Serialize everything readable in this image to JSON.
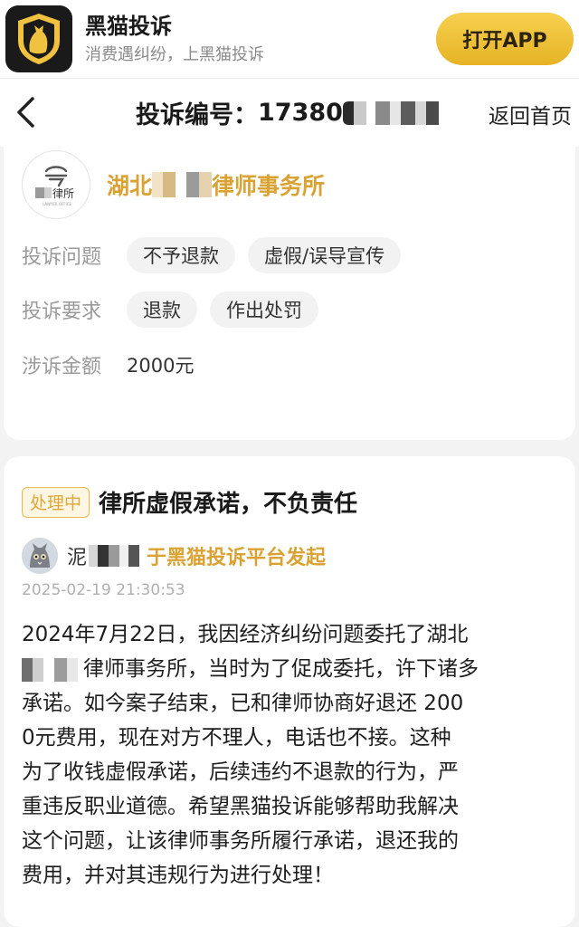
{
  "app_banner": {
    "name": "黑猫投诉",
    "slogan": "消费遇纠纷，上黑猫投诉",
    "open_button": "打开APP",
    "logo_icon": "black-cat-shield-icon"
  },
  "nav": {
    "back_icon": "chevron-left-icon",
    "title_prefix": "投诉编号：",
    "title_number_visible": "17380",
    "home_link": "返回首页"
  },
  "company": {
    "logo_text": "律所",
    "name_prefix": "湖北",
    "name_suffix": "律师事务所",
    "issues_label": "投诉问题",
    "issues": [
      "不予退款",
      "虚假/误导宣传"
    ],
    "requests_label": "投诉要求",
    "requests": [
      "退款",
      "作出处罚"
    ],
    "amount_label": "涉诉金额",
    "amount": "2000元"
  },
  "complaint": {
    "status": "处理中",
    "title": "律所虚假承诺，不负责任",
    "user_name_visible": "泥",
    "platform_text": "于黑猫投诉平台发起",
    "timestamp": "2025-02-19 21:30:53",
    "body_lines": [
      "2024年7月22日，我因经济纠纷问题委托了湖北",
      "律师事务所，当时为了促成委托，许下诸多",
      "承诺。如今案子结束，已和律师协商好退还 200",
      "0元费用，现在对方不理人，电话也不接。这种",
      "为了收钱虚假承诺，后续违约不退款的行为，严",
      "重违反职业道德。希望黑猫投诉能够帮助我解决",
      "这个问题，让该律师事务所履行承诺，退还我的",
      "费用，并对其违规行为进行处理！"
    ]
  },
  "colors": {
    "accent_gold": "#d9a232",
    "button_gold": "#e6b325",
    "status_orange": "#e0a73a",
    "page_bg": "#f3f3f3"
  }
}
